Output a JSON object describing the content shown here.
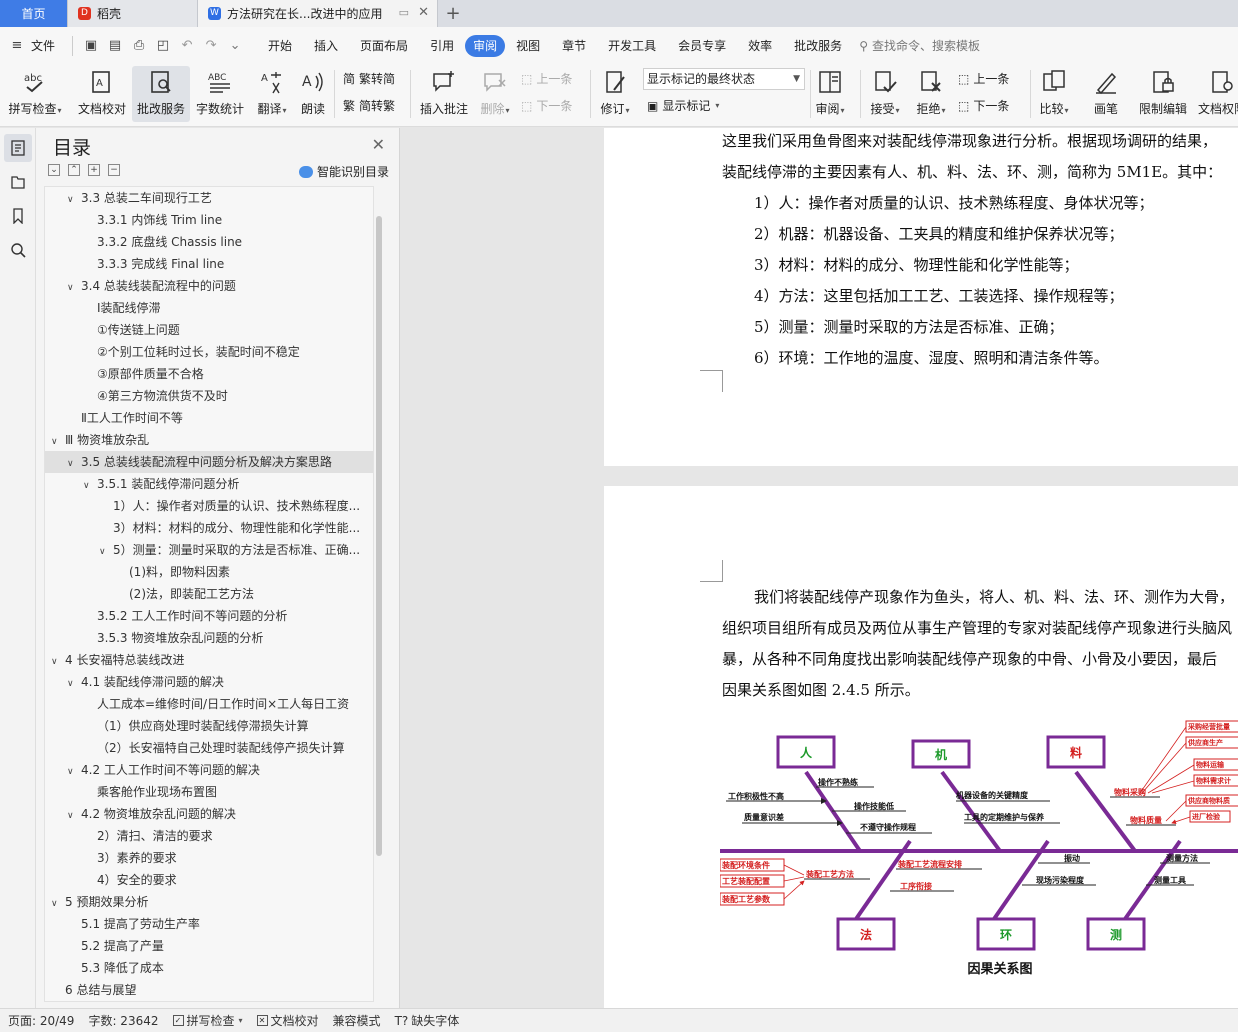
{
  "tabs": {
    "home": "首页",
    "daoke": "稻壳",
    "document": "方法研究在长...改进中的应用"
  },
  "menu": {
    "file": "文件",
    "items": [
      "开始",
      "插入",
      "页面布局",
      "引用",
      "审阅",
      "视图",
      "章节",
      "开发工具",
      "会员专享",
      "效率",
      "批改服务"
    ],
    "active": "审阅",
    "search_placeholder": "查找命令、搜索模板"
  },
  "ribbon": {
    "spell_check": "拼写检查",
    "doc_proof": "文档校对",
    "correction_service": "批改服务",
    "word_count": "字数统计",
    "translate": "翻译",
    "read_aloud": "朗读",
    "trad_simp": "繁转简",
    "simp_trad": "简转繁",
    "insert_comment": "插入批注",
    "delete": "删除",
    "prev_comment": "上一条",
    "next_comment": "下一条",
    "revise": "修订",
    "markup_state": "显示标记的最终状态",
    "show_markup": "显示标记",
    "review": "审阅",
    "accept": "接受",
    "reject": "拒绝",
    "prev_change": "上一条",
    "next_change": "下一条",
    "compare": "比较",
    "pen": "画笔",
    "restrict_edit": "限制编辑",
    "doc_permission": "文档权限"
  },
  "toc": {
    "title": "目录",
    "smart": "智能识别目录",
    "items": [
      {
        "text": "3.3 总装二车间现行工艺",
        "indent": 2,
        "arrow": "v"
      },
      {
        "text": "3.3.1 内饰线  Trim line",
        "indent": 3,
        "arrow": ""
      },
      {
        "text": "3.3.2 底盘线  Chassis line",
        "indent": 3,
        "arrow": ""
      },
      {
        "text": "3.3.3 完成线  Final line",
        "indent": 3,
        "arrow": ""
      },
      {
        "text": "3.4 总装线装配流程中的问题",
        "indent": 2,
        "arrow": "v"
      },
      {
        "text": "Ⅰ装配线停滞",
        "indent": 3,
        "arrow": ""
      },
      {
        "text": "①传送链上问题",
        "indent": 3,
        "arrow": ""
      },
      {
        "text": "②个别工位耗时过长，装配时间不稳定",
        "indent": 3,
        "arrow": ""
      },
      {
        "text": "③原部件质量不合格",
        "indent": 3,
        "arrow": ""
      },
      {
        "text": "④第三方物流供货不及时",
        "indent": 3,
        "arrow": ""
      },
      {
        "text": "Ⅱ工人工作时间不等",
        "indent": 2,
        "arrow": ""
      },
      {
        "text": "Ⅲ 物资堆放杂乱",
        "indent": 1,
        "arrow": "v"
      },
      {
        "text": "3.5 总装线装配流程中问题分析及解决方案思路",
        "indent": 2,
        "arrow": "v",
        "selected": true
      },
      {
        "text": "3.5.1 装配线停滞问题分析",
        "indent": 3,
        "arrow": "v"
      },
      {
        "text": "1）人：操作者对质量的认识、技术熟练程度...",
        "indent": 4,
        "arrow": ""
      },
      {
        "text": "3）材料：材料的成分、物理性能和化学性能...",
        "indent": 4,
        "arrow": ""
      },
      {
        "text": "5）测量：测量时采取的方法是否标准、正确...",
        "indent": 4,
        "arrow": "v"
      },
      {
        "text": "(1)料，即物料因素",
        "indent": 5,
        "arrow": ""
      },
      {
        "text": "(2)法，即装配工艺方法",
        "indent": 5,
        "arrow": ""
      },
      {
        "text": "3.5.2 工人工作时间不等问题的分析",
        "indent": 3,
        "arrow": ""
      },
      {
        "text": "3.5.3 物资堆放杂乱问题的分析",
        "indent": 3,
        "arrow": ""
      },
      {
        "text": "4  长安福特总装线改进",
        "indent": 1,
        "arrow": "v"
      },
      {
        "text": "4.1 装配线停滞问题的解决",
        "indent": 2,
        "arrow": "v"
      },
      {
        "text": "人工成本=维修时间/日工作时间×工人每日工资",
        "indent": 3,
        "arrow": ""
      },
      {
        "text": "（1）供应商处理时装配线停滞损失计算",
        "indent": 3,
        "arrow": ""
      },
      {
        "text": "（2）长安福特自己处理时装配线停产损失计算",
        "indent": 3,
        "arrow": ""
      },
      {
        "text": "4.2 工人工作时间不等问题的解决",
        "indent": 2,
        "arrow": "v"
      },
      {
        "text": "乘客舱作业现场布置图",
        "indent": 3,
        "arrow": ""
      },
      {
        "text": "4.2 物资堆放杂乱问题的解决",
        "indent": 2,
        "arrow": "v"
      },
      {
        "text": "2）清扫、清洁的要求",
        "indent": 3,
        "arrow": ""
      },
      {
        "text": "3）素养的要求",
        "indent": 3,
        "arrow": ""
      },
      {
        "text": "4）安全的要求",
        "indent": 3,
        "arrow": ""
      },
      {
        "text": "5  预期效果分析",
        "indent": 1,
        "arrow": "v"
      },
      {
        "text": "5.1 提高了劳动生产率",
        "indent": 2,
        "arrow": ""
      },
      {
        "text": "5.2 提高了产量",
        "indent": 2,
        "arrow": ""
      },
      {
        "text": "5.3 降低了成本",
        "indent": 2,
        "arrow": ""
      },
      {
        "text": "6  总结与展望",
        "indent": 1,
        "arrow": ""
      }
    ]
  },
  "doc": {
    "page1": [
      "这里我们采用鱼骨图来对装配线停滞现象进行分析。根据现场调研的结果，",
      "装配线停滞的主要因素有人、机、料、法、环、测，简称为 5M1E。其中：",
      "1）人：操作者对质量的认识、技术熟练程度、身体状况等；",
      "2）机器：机器设备、工夹具的精度和维护保养状况等；",
      "3）材料：材料的成分、物理性能和化学性能等；",
      "4）方法：这里包括加工工艺、工装选择、操作规程等；",
      "5）测量：测量时采取的方法是否标准、正确；",
      "6）环境：工作地的温度、湿度、照明和清洁条件等。"
    ],
    "page2": [
      "我们将装配线停产现象作为鱼头，将人、机、料、法、环、测作为大骨，",
      "组织项目组所有成员及两位从事生产管理的专家对装配线停产现象进行头脑风",
      "暴，从各种不同角度找出影响装配线停产现象的中骨、小骨及小要因，最后",
      "因果关系图如图 2.4.5 所示。"
    ],
    "fishbone": {
      "categories": [
        "人",
        "机",
        "料",
        "法",
        "环",
        "测"
      ],
      "ren": [
        "操作不熟练",
        "工作积极性不高",
        "操作技能低",
        "质量意识差",
        "不遵守操作规程"
      ],
      "ji": [
        "机器设备的关键精度",
        "工具的定期维护与保养"
      ],
      "liao_main": [
        "物料采购",
        "物料质量"
      ],
      "liao_red": [
        "采购经营批量",
        "供应商生产",
        "物料运输",
        "物料需求计",
        "供应商物料质",
        "进厂检验"
      ],
      "fa_red": [
        "装配环境条件",
        "工艺装配配置",
        "装配工艺参数",
        "装配工艺方法",
        "装配工艺流程安排",
        "工序衔接"
      ],
      "huan": [
        "振动",
        "现场污染程度"
      ],
      "ce": [
        "测量方法",
        "测量工具"
      ],
      "caption": "因果关系图"
    }
  },
  "status": {
    "page": "页面: 20/49",
    "words": "字数: 23642",
    "spell": "拼写检查",
    "proof": "文档校对",
    "compat": "兼容模式",
    "missing_font": "缺失字体"
  },
  "colors": {
    "accent": "#3b7be4",
    "fish_bone": "#7a2a95",
    "fish_red": "#d42020",
    "fish_green": "#1d9a2b"
  }
}
